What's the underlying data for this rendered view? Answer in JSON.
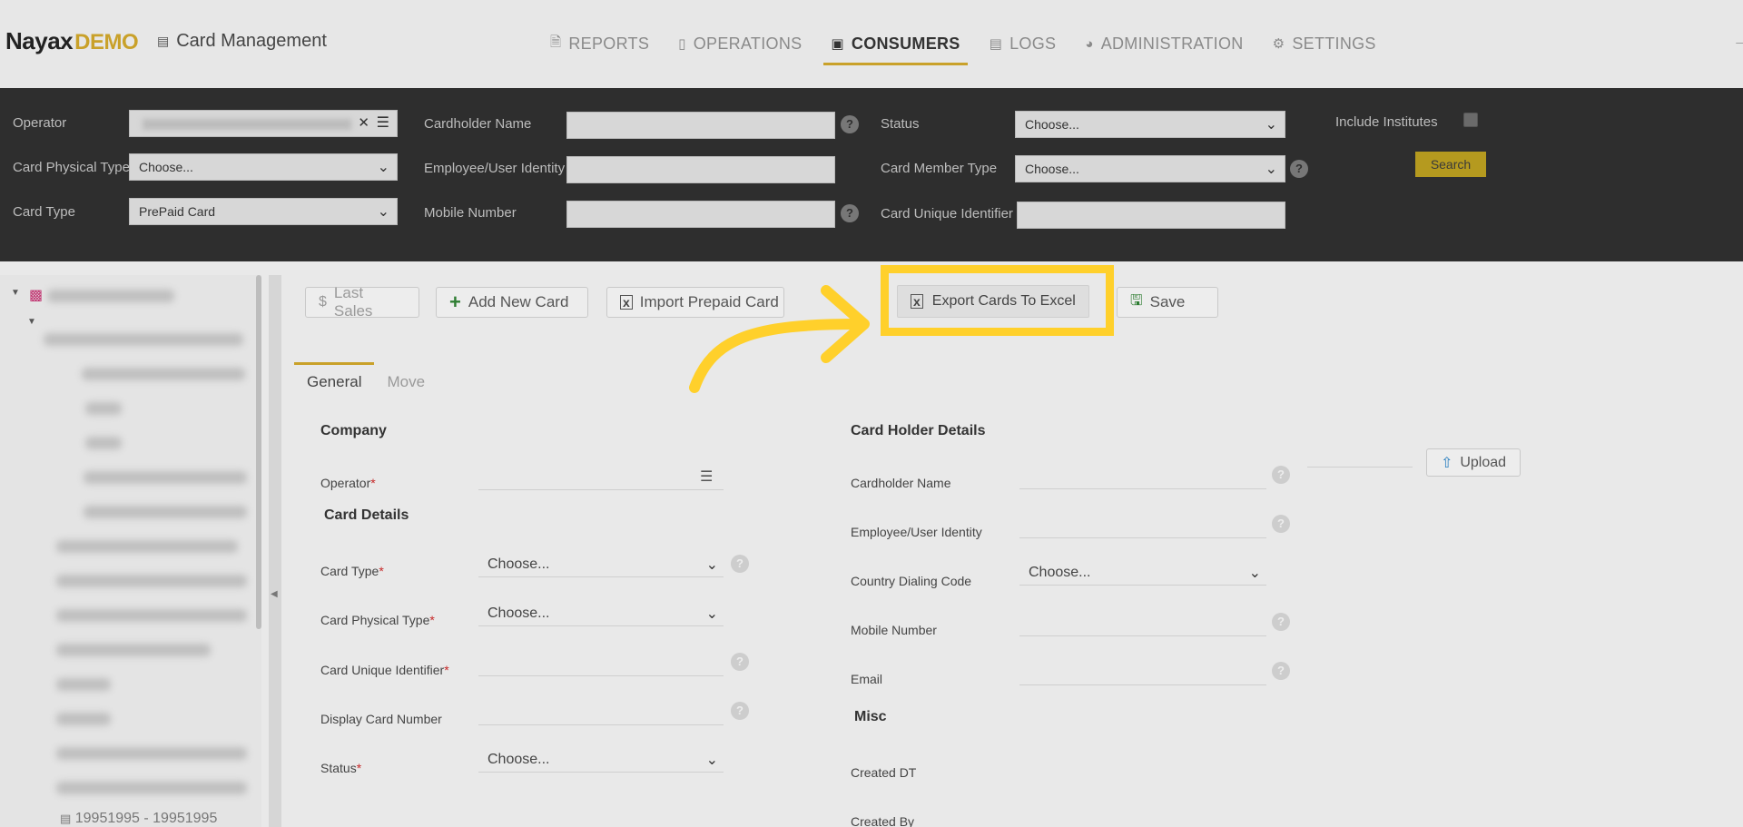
{
  "header": {
    "logo_main": "Nayax",
    "logo_demo": "DEMO",
    "app_title": "Card Management",
    "nav": [
      {
        "label": "REPORTS",
        "icon": "document-icon"
      },
      {
        "label": "OPERATIONS",
        "icon": "device-icon"
      },
      {
        "label": "CONSUMERS",
        "icon": "badge-icon",
        "active": true
      },
      {
        "label": "LOGS",
        "icon": "log-icon"
      },
      {
        "label": "ADMINISTRATION",
        "icon": "dashboard-icon"
      },
      {
        "label": "SETTINGS",
        "icon": "gear-icon"
      }
    ]
  },
  "filters": {
    "operator_label": "Operator",
    "card_physical_type_label": "Card Physical Type",
    "card_physical_type_value": "Choose...",
    "card_type_label": "Card Type",
    "card_type_value": "PrePaid Card",
    "cardholder_name_label": "Cardholder Name",
    "employee_identity_label": "Employee/User Identity",
    "mobile_number_label": "Mobile Number",
    "status_label": "Status",
    "status_value": "Choose...",
    "card_member_type_label": "Card Member Type",
    "card_member_type_value": "Choose...",
    "card_unique_identifier_label": "Card Unique Identifier",
    "include_institutes_label": "Include Institutes",
    "search_label": "Search"
  },
  "tree": {
    "last_item": "19951995 - 19951995"
  },
  "toolbar": {
    "last_sales": "Last Sales",
    "add_new_card": "Add New Card",
    "import_prepaid": "Import Prepaid Card",
    "export_excel": "Export Cards To Excel",
    "save": "Save"
  },
  "tabs": {
    "general": "General",
    "move": "Move"
  },
  "form": {
    "company_section": "Company",
    "operator_label": "Operator",
    "card_details_section": "Card Details",
    "card_type_label": "Card Type",
    "card_type_value": "Choose...",
    "card_physical_type_label": "Card Physical Type",
    "card_physical_type_value": "Choose...",
    "card_unique_identifier_label": "Card Unique Identifier",
    "display_card_number_label": "Display Card Number",
    "status_label": "Status",
    "status_value": "Choose...",
    "holder_section": "Card Holder Details",
    "cardholder_name_label": "Cardholder Name",
    "employee_identity_label": "Employee/User Identity",
    "country_dialing_label": "Country Dialing Code",
    "country_dialing_value": "Choose...",
    "mobile_number_label": "Mobile Number",
    "email_label": "Email",
    "misc_section": "Misc",
    "created_dt_label": "Created DT",
    "created_by_label": "Created By",
    "upload_label": "Upload",
    "required_mark": "*"
  },
  "colors": {
    "accent": "#c9a12a",
    "highlight": "#ffd02b",
    "filter_bg": "#2e2e2e"
  }
}
